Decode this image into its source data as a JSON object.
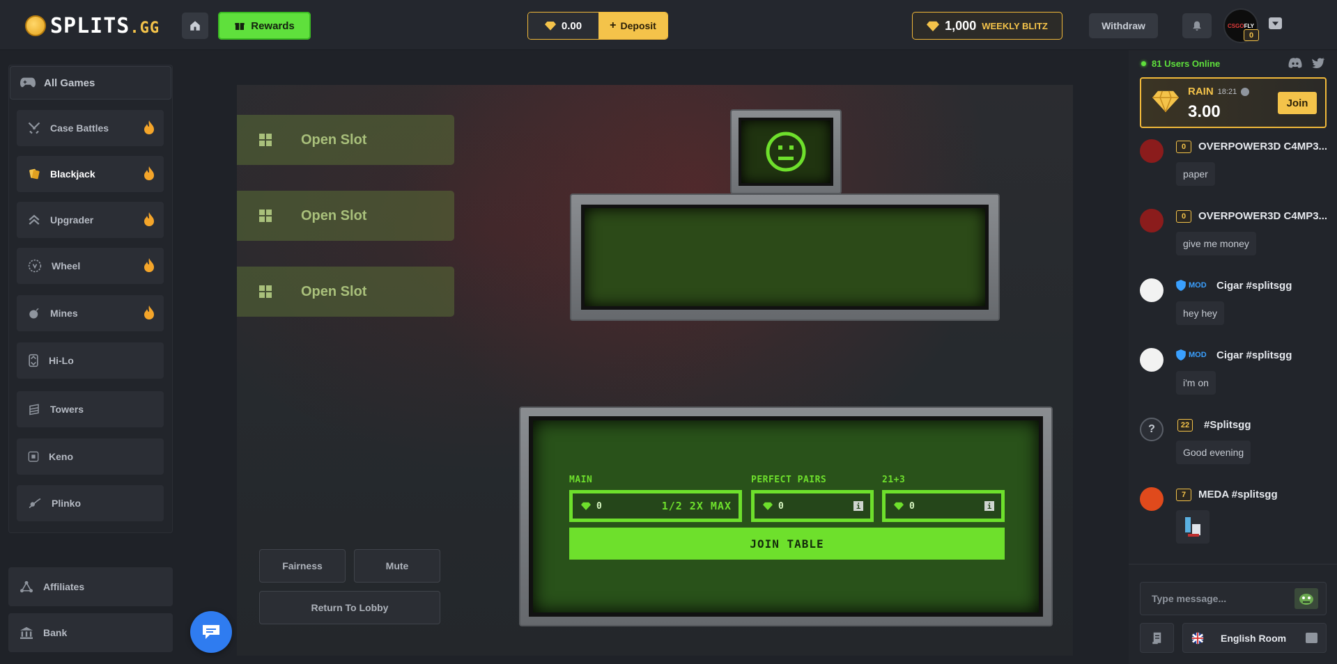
{
  "brand": {
    "logo_main": "SPLITS",
    "logo_tld": ".GG"
  },
  "header": {
    "rewards_label": "Rewards",
    "balance": "0.00",
    "deposit_label": "Deposit",
    "blitz_amount": "1,000",
    "blitz_label": "WEEKLY BLITZ",
    "withdraw_label": "Withdraw",
    "avatar_text_a": "CSGO",
    "avatar_text_b": "FLY",
    "user_level": "0"
  },
  "sidebar": {
    "all_games": "All Games",
    "items": [
      {
        "label": "Case Battles",
        "hot": true
      },
      {
        "label": "Blackjack",
        "hot": true,
        "active": true
      },
      {
        "label": "Upgrader",
        "hot": true
      },
      {
        "label": "Wheel",
        "hot": true
      },
      {
        "label": "Mines",
        "hot": true
      },
      {
        "label": "Hi-Lo",
        "hot": false
      },
      {
        "label": "Towers",
        "hot": false
      },
      {
        "label": "Keno",
        "hot": false
      },
      {
        "label": "Plinko",
        "hot": false
      }
    ],
    "affiliates": "Affiliates",
    "bank": "Bank"
  },
  "game": {
    "slots": [
      "Open Slot",
      "Open Slot",
      "Open Slot"
    ],
    "bets": {
      "main_label": "MAIN",
      "main_value": "0",
      "main_hint": "1/2 2X MAX",
      "pairs_label": "PERFECT PAIRS",
      "pairs_value": "0",
      "plus_label": "21+3",
      "plus_value": "0"
    },
    "join_label": "JOIN TABLE",
    "fairness_label": "Fairness",
    "mute_label": "Mute",
    "lobby_label": "Return To Lobby"
  },
  "chat": {
    "online": "81 Users Online",
    "rain": {
      "title": "RAIN",
      "timer": "18:21",
      "amount": "3.00",
      "join_label": "Join"
    },
    "messages": [
      {
        "level": "0",
        "name": "OVERPOWER3D C4MP3...",
        "text": "paper"
      },
      {
        "level": "0",
        "name": "OVERPOWER3D C4MP3...",
        "text": "give me money"
      },
      {
        "mod": "MOD",
        "name": "Cigar #splitsgg",
        "text": "hey hey"
      },
      {
        "mod": "MOD",
        "name": "Cigar #splitsgg",
        "text": "i'm on"
      },
      {
        "level": "22",
        "name": "#Splitsgg",
        "text": "Good evening",
        "avatar": "?"
      },
      {
        "level": "7",
        "name": "MEDA #splitsgg",
        "text": ""
      }
    ],
    "input_placeholder": "Type message...",
    "room_label": "English Room"
  }
}
